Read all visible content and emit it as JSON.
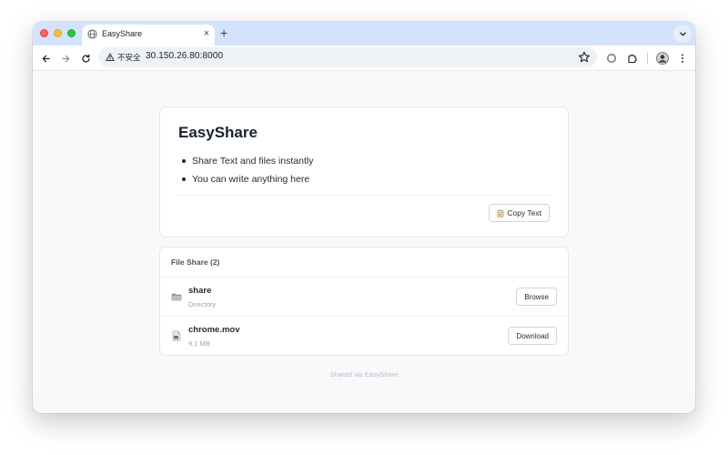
{
  "browser": {
    "tab_title": "EasyShare",
    "tab_close_glyph": "×",
    "new_tab_glyph": "+",
    "security_label": "不安全",
    "url": "30.150.26.80:8000"
  },
  "text_card": {
    "title": "EasyShare",
    "bullets": [
      "Share Text and files instantly",
      "You can write anything here"
    ],
    "copy_label": "Copy Text"
  },
  "files": {
    "header": "File Share (2)",
    "items": [
      {
        "name": "share",
        "meta": "Directory",
        "action": "Browse",
        "icon": "folder-icon"
      },
      {
        "name": "chrome.mov",
        "meta": "9.1 MB",
        "action": "Download",
        "icon": "file-icon"
      }
    ]
  },
  "footer": "Shared via EasyShare",
  "colors": {
    "tabstrip": "#d3e3fd",
    "page_bg": "#f8f9fb",
    "card_border": "#e5e7eb",
    "title": "#1a2230"
  }
}
